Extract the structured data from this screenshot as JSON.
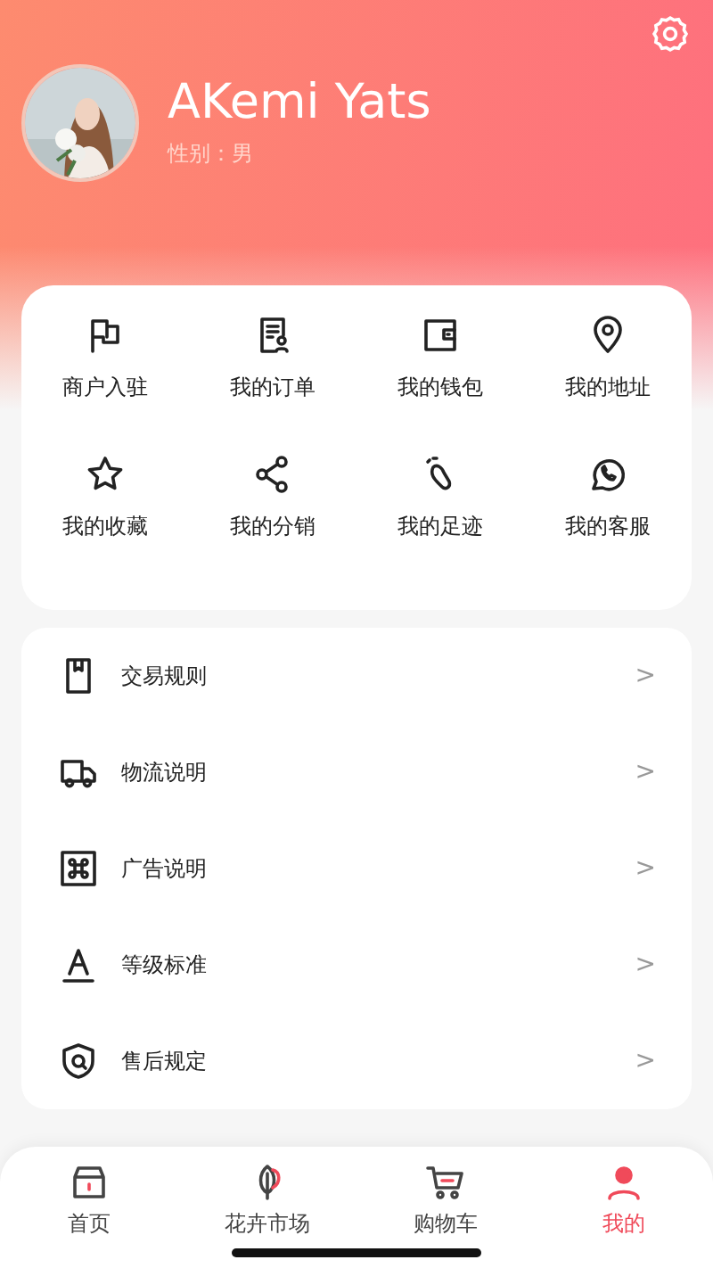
{
  "profile": {
    "name": "AKemi Yats",
    "gender": "性别：男"
  },
  "shortcuts": [
    {
      "label": "商户入驻"
    },
    {
      "label": "我的订单"
    },
    {
      "label": "我的钱包"
    },
    {
      "label": "我的地址"
    },
    {
      "label": "我的收藏"
    },
    {
      "label": "我的分销"
    },
    {
      "label": "我的足迹"
    },
    {
      "label": "我的客服"
    }
  ],
  "menu": [
    {
      "label": "交易规则",
      "chevron": ">"
    },
    {
      "label": "物流说明",
      "chevron": ">"
    },
    {
      "label": "广告说明",
      "chevron": ">"
    },
    {
      "label": "等级标准",
      "chevron": ">"
    },
    {
      "label": "售后规定",
      "chevron": ">"
    }
  ],
  "tabbar": [
    {
      "label": "首页",
      "selected": false
    },
    {
      "label": "花卉市场",
      "selected": false
    },
    {
      "label": "购物车",
      "selected": false
    },
    {
      "label": "我的",
      "selected": true
    }
  ]
}
